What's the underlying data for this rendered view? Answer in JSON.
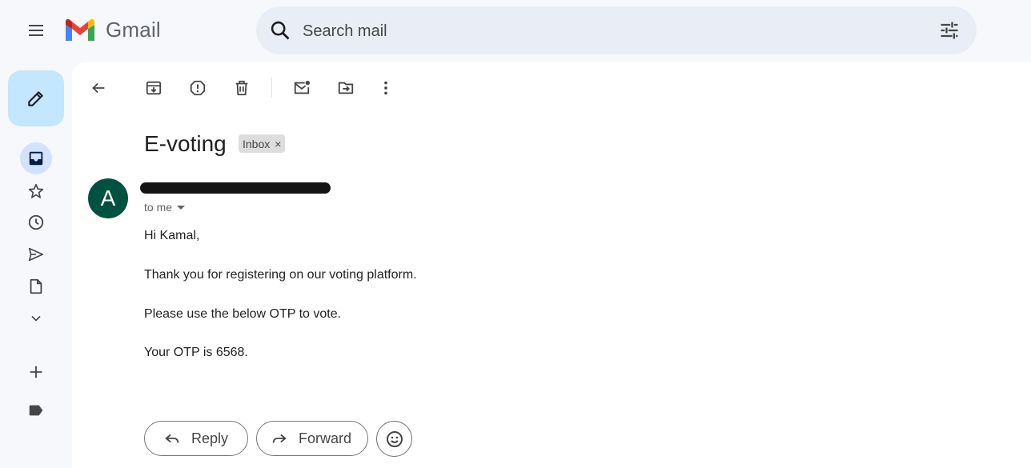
{
  "app": {
    "logo_text": "Gmail"
  },
  "search": {
    "placeholder": "Search mail",
    "value": ""
  },
  "toolbar": {
    "icons": [
      "back-icon",
      "archive-icon",
      "report-spam-icon",
      "delete-icon",
      "mark-unread-icon",
      "move-to-icon",
      "more-options-icon"
    ]
  },
  "rail": {
    "items": [
      "inbox-icon",
      "star-icon",
      "clock-icon",
      "send-icon",
      "draft-icon",
      "chevron-down-icon",
      "plus-icon",
      "label-icon"
    ]
  },
  "email": {
    "subject": "E-voting",
    "label": "Inbox",
    "label_remove": "×",
    "avatar_letter": "A",
    "recipient": "to me",
    "body": [
      "Hi Kamal,",
      "Thank you for registering on our voting platform.",
      "Please use the below OTP to vote.",
      "Your OTP is 6568."
    ]
  },
  "actions": {
    "reply": "Reply",
    "forward": "Forward"
  },
  "colors": {
    "background": "#f6f8fc",
    "search_bg": "#e9eef6",
    "compose_bg": "#c2e7ff",
    "active_item_bg": "#d3e3fd",
    "avatar_bg": "#00513f",
    "label_bg": "#dddddd"
  }
}
